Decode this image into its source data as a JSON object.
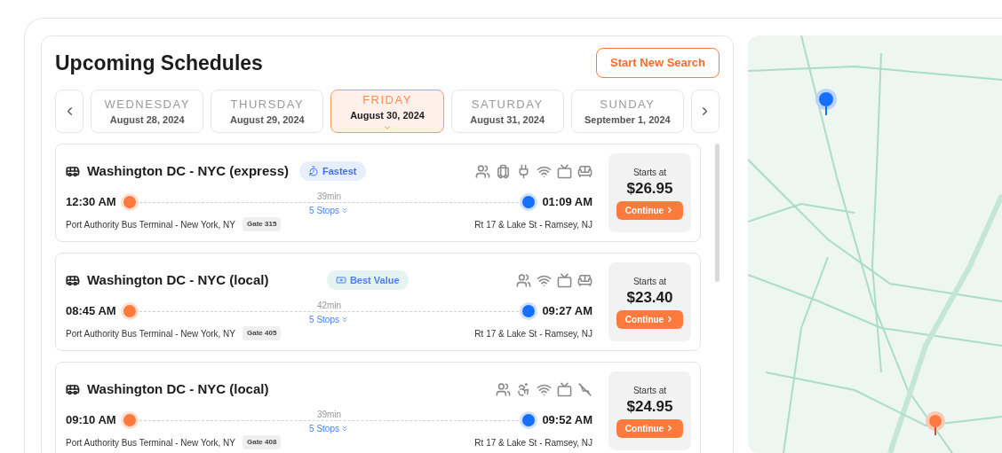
{
  "header": {
    "title": "Upcoming Schedules",
    "new_search_button": "Start New Search"
  },
  "days": [
    {
      "weekday": "WEDNESDAY",
      "date": "August 28, 2024",
      "selected": false
    },
    {
      "weekday": "THURSDAY",
      "date": "August 29, 2024",
      "selected": false
    },
    {
      "weekday": "FRIDAY",
      "date": "August 30, 2024",
      "selected": true
    },
    {
      "weekday": "SATURDAY",
      "date": "August 31, 2024",
      "selected": false
    },
    {
      "weekday": "SUNDAY",
      "date": "September 1, 2024",
      "selected": false
    }
  ],
  "trips": [
    {
      "route": "Washington DC - NYC (express)",
      "badge": {
        "kind": "fastest",
        "label": "Fastest"
      },
      "amenities": [
        {
          "kind": "restroom"
        },
        {
          "kind": "luggage"
        },
        {
          "kind": "power"
        },
        {
          "kind": "wifi"
        },
        {
          "kind": "tv"
        },
        {
          "kind": "seat"
        }
      ],
      "depart_time": "12:30 AM",
      "arrive_time": "01:09 AM",
      "duration": "39min",
      "stops": "5 Stops",
      "origin": "Port Authority Bus Terminal - New York, NY",
      "gate": "Gate 315",
      "destination": "Rt 17 & Lake St - Ramsey, NJ",
      "price_label": "Starts at",
      "price": "$26.95",
      "button": "Continue"
    },
    {
      "route": "Washington DC - NYC (local)",
      "badge": {
        "kind": "best-value",
        "label": "Best Value"
      },
      "amenities": [
        {
          "kind": "restroom"
        },
        {
          "kind": "wifi"
        },
        {
          "kind": "tv"
        },
        {
          "kind": "seat"
        }
      ],
      "depart_time": "08:45 AM",
      "arrive_time": "09:27 AM",
      "duration": "42min",
      "stops": "5 Stops",
      "origin": "Port Authority Bus Terminal - New York, NY",
      "gate": "Gate 405",
      "destination": "Rt 17 & Lake St - Ramsey, NJ",
      "price_label": "Starts at",
      "price": "$23.40",
      "button": "Continue"
    },
    {
      "route": "Washington DC - NYC (local)",
      "amenities": [
        {
          "kind": "restroom"
        },
        {
          "kind": "accessible"
        },
        {
          "kind": "wifi"
        },
        {
          "kind": "tv"
        },
        {
          "kind": "no-recline"
        }
      ],
      "depart_time": "09:10 AM",
      "arrive_time": "09:52 AM",
      "duration": "39min",
      "stops": "5 Stops",
      "origin": "Port Authority Bus Terminal - New York, NY",
      "gate": "Gate 408",
      "destination": "Rt 17 & Lake St - Ramsey, NJ",
      "price_label": "Starts at",
      "price": "$24.95",
      "button": "Continue"
    }
  ]
}
